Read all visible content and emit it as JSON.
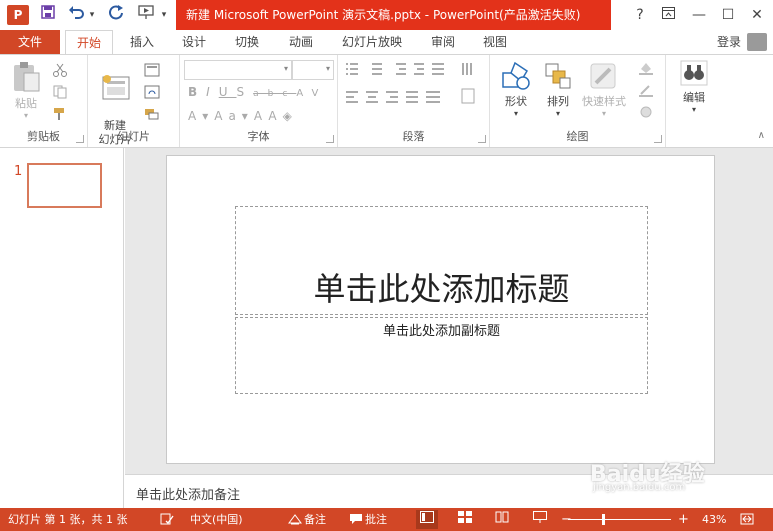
{
  "window": {
    "title": "新建 Microsoft PowerPoint 演示文稿.pptx - PowerPoint(产品激活失败)",
    "app_icon": "P",
    "help": "?",
    "ribbon_display": "▣",
    "minimize": "—",
    "maximize": "☐",
    "close": "✕"
  },
  "qat": {
    "save": "💾",
    "undo": "↶",
    "redo": "↻",
    "customize": "▾"
  },
  "tabs": {
    "file": "文件",
    "items": [
      "开始",
      "插入",
      "设计",
      "切换",
      "动画",
      "幻灯片放映",
      "审阅",
      "视图"
    ],
    "login": "登录"
  },
  "ribbon": {
    "clipboard": {
      "label": "剪贴板",
      "paste": "粘贴"
    },
    "slides": {
      "label": "幻灯片",
      "new_slide": "新建\n幻灯片"
    },
    "font": {
      "label": "字体"
    },
    "paragraph": {
      "label": "段落"
    },
    "drawing": {
      "label": "绘图",
      "shapes": "形状",
      "arrange": "排列",
      "quick_styles": "快速样式"
    },
    "editing": {
      "edit": "编辑"
    }
  },
  "thumbnails": {
    "slide_number": "1"
  },
  "slide": {
    "title_placeholder": "单击此处添加标题",
    "subtitle_placeholder": "单击此处添加副标题"
  },
  "notes": {
    "placeholder": "单击此处添加备注"
  },
  "status": {
    "slide_info": "幻灯片 第 1 张，共 1 张",
    "language": "中文(中国)",
    "notes": "备注",
    "comments": "批注",
    "zoom_minus": "−",
    "zoom_plus": "+",
    "zoom": "43%",
    "zoom_fraction": 0.43
  },
  "watermark": {
    "brand": "Baidu经验",
    "url": "jingyan.baidu.com"
  },
  "colors": {
    "accent": "#d24726",
    "title_red": "#e3321a",
    "canvas": "#e8e8e8"
  }
}
